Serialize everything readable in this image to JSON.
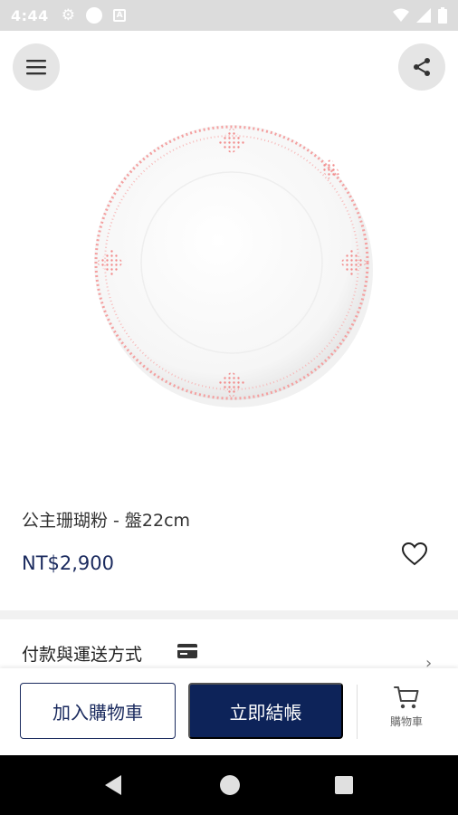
{
  "status_bar": {
    "time": "4:44"
  },
  "icons": {
    "menu": "menu-icon",
    "share": "share-icon",
    "heart": "heart-icon",
    "card": "credit-card-icon",
    "cart": "cart-icon"
  },
  "product": {
    "name": "公主珊瑚粉 - 盤22cm",
    "price": "NT$2,900"
  },
  "payment": {
    "label": "付款與運送方式"
  },
  "actions": {
    "add_to_cart": "加入購物車",
    "checkout": "立即結帳",
    "cart_tab": "購物車"
  },
  "colors": {
    "brand_navy": "#0d2359",
    "price_text": "#1a2a5e",
    "plate_pattern": "#f28b8b"
  }
}
